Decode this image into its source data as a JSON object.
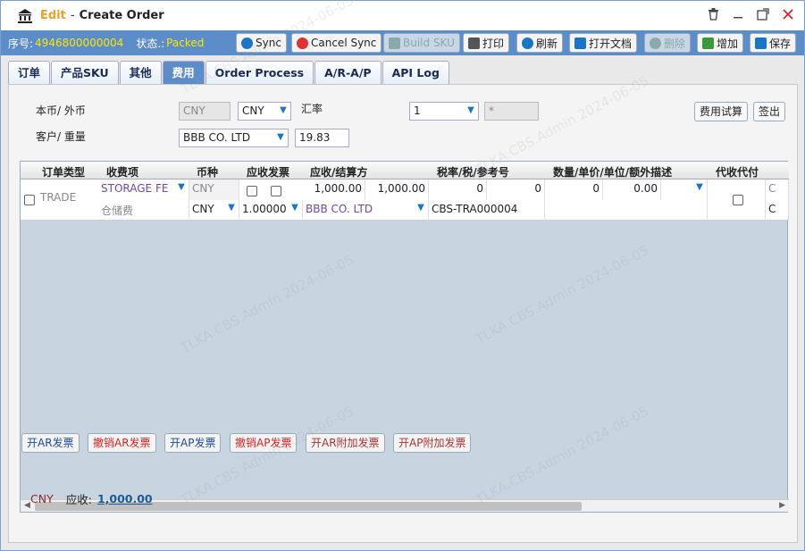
{
  "window": {
    "edit_label": "Edit",
    "separator": "-",
    "title": "Create Order"
  },
  "toolbar": {
    "seq_label": "序号:",
    "seq_value": "4946800000004",
    "status_label": "状态.:",
    "status_value": "Packed",
    "buttons": {
      "sync": "Sync",
      "cancel_sync": "Cancel Sync",
      "build_sku": "Build SKU",
      "print": "打印",
      "refresh": "刷新",
      "open_doc": "打开文档",
      "delete": "删除",
      "add": "增加",
      "save": "保存"
    }
  },
  "tabs": [
    "订单",
    "产品SKU",
    "其他",
    "费用",
    "Order Process",
    "A/R-A/P",
    "API Log"
  ],
  "form": {
    "currency_label": "本币/ 外币",
    "base_currency": "CNY",
    "foreign_currency": "CNY",
    "rate_label": "汇率",
    "rate_value": "1",
    "rate_extra": "*",
    "customer_label": "客户/ 重量",
    "customer_value": "BBB CO. LTD",
    "weight_value": "19.83",
    "calc_button": "费用试算",
    "signout_button": "签出"
  },
  "grid": {
    "headers": [
      "订单类型",
      "收费项",
      "币种",
      "应收发票",
      "应收/结算方",
      "税率/税/参考号",
      "数量/单价/单位/额外描述",
      "代收代付"
    ],
    "row": {
      "order_type": "TRADE",
      "charge_item": "STORAGE FE",
      "charge_item_cn": "仓储费",
      "currency_top": "CNY",
      "currency": "CNY",
      "rate": "1.00000",
      "amount1": "1,000.00",
      "amount2": "1,000.00",
      "party": "BBB CO. LTD",
      "tax_rate": "0",
      "tax": "0",
      "reference": "CBS-TRA000004",
      "qty": "0",
      "unit_price": "0.00",
      "extra_c1": "C",
      "extra_c2": "C"
    }
  },
  "footer": {
    "currency": "CNY",
    "receivable_label": "应收:",
    "receivable_value": "1,000.00"
  },
  "bottom_buttons": {
    "open_ar": "开AR发票",
    "cancel_ar": "撤销AR发票",
    "open_ap": "开AP发票",
    "cancel_ap": "撤销AP发票",
    "open_ar_extra": "开AR附加发票",
    "open_ap_extra": "开AP附加发票"
  },
  "watermark": "TLKA.CBS.Admin 2024-06-05",
  "colors": {
    "accent": "#5c8dc9",
    "status": "#ffe600",
    "title_edit": "#f0a020"
  }
}
